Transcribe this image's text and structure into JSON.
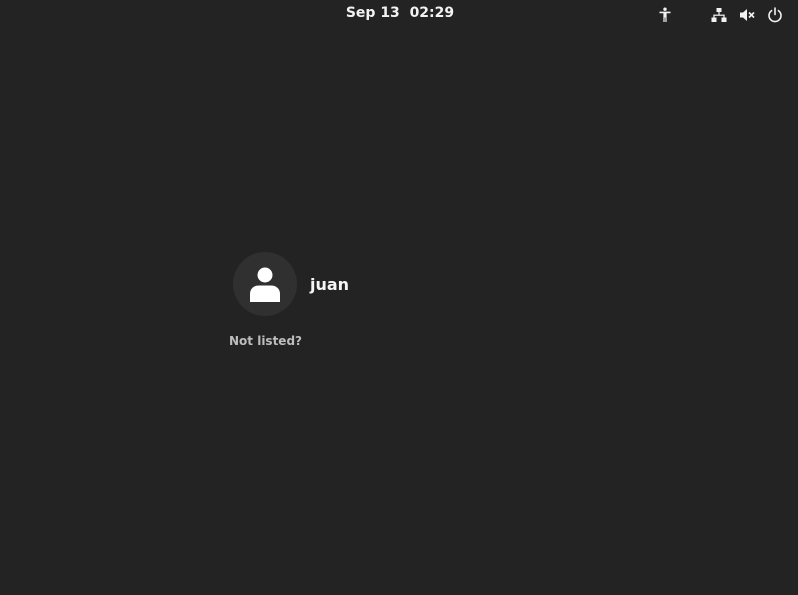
{
  "topbar": {
    "date": "Sep 13",
    "time": "02:29",
    "icons": {
      "accessibility": "accessibility-icon",
      "network": "network-wired-icon",
      "volume": "volume-muted-icon",
      "power": "power-icon"
    }
  },
  "login": {
    "users": [
      {
        "name": "juan",
        "avatar_icon": "user-icon"
      }
    ],
    "not_listed_label": "Not listed?"
  },
  "colors": {
    "background": "#232323",
    "avatar_bg": "#303030",
    "text": "#f5f5f5",
    "muted_text": "#bdbdbd"
  }
}
